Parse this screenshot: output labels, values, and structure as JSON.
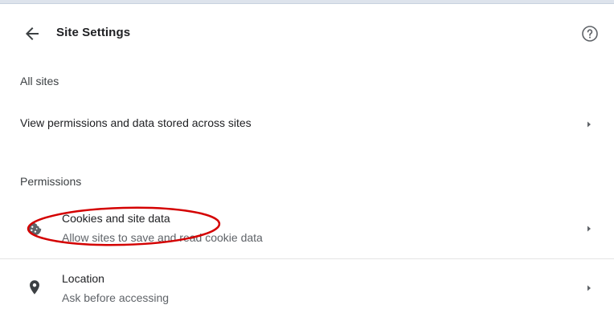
{
  "header": {
    "title": "Site Settings",
    "back_icon": "arrow-left-icon",
    "help_icon": "help-circle-icon"
  },
  "sections": {
    "all_sites_heading": "All sites",
    "permissions_heading": "Permissions"
  },
  "rows": {
    "view_permissions": {
      "label": "View permissions and data stored across sites"
    },
    "cookies": {
      "label": "Cookies and site data",
      "sublabel": "Allow sites to save and read cookie data",
      "icon": "cookie-icon"
    },
    "location": {
      "label": "Location",
      "sublabel": "Ask before accessing",
      "icon": "location-pin-icon"
    }
  },
  "colors": {
    "annotation": "#d40000",
    "text_primary": "#202124",
    "text_secondary": "#5f6368",
    "icon": "#5f6368"
  }
}
